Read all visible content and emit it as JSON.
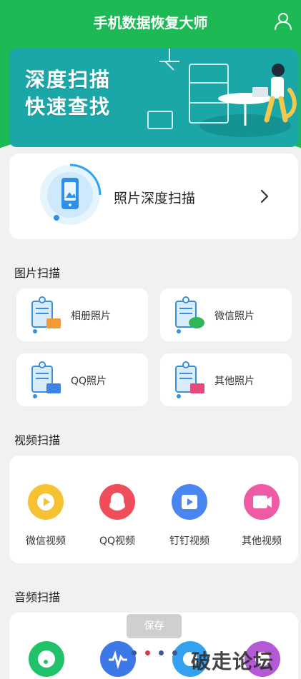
{
  "app": {
    "title": "手机数据恢复大师"
  },
  "banner": {
    "line1": "深度扫描",
    "line2": "快速查找"
  },
  "deep_scan": {
    "label": "照片深度扫描"
  },
  "image_scan": {
    "title": "图片扫描",
    "items": [
      {
        "label": "相册照片",
        "icon": "album-photo-icon",
        "accent": "#f29a38"
      },
      {
        "label": "微信照片",
        "icon": "wechat-photo-icon",
        "accent": "#2fb65a"
      },
      {
        "label": "QQ照片",
        "icon": "qq-photo-icon",
        "accent": "#3d82e6"
      },
      {
        "label": "其他照片",
        "icon": "other-photo-icon",
        "accent": "#e6497a"
      }
    ]
  },
  "video_scan": {
    "title": "视频扫描",
    "items": [
      {
        "label": "微信视频",
        "icon": "wechat-video-icon",
        "color": "#f6c234"
      },
      {
        "label": "QQ视频",
        "icon": "qq-video-icon",
        "color": "#f04d5a"
      },
      {
        "label": "钉钉视频",
        "icon": "dingtalk-video-icon",
        "color": "#4a86ef"
      },
      {
        "label": "其他视频",
        "icon": "other-video-icon",
        "color": "#ee5aa6"
      }
    ]
  },
  "audio_scan": {
    "title": "音频扫描"
  },
  "toast": {
    "label": "保存"
  },
  "pager": {
    "pages": 4,
    "active": 2,
    "active_color": "#e0364a",
    "inactive_color": "#3a5a8a"
  },
  "watermark": {
    "text": "破走论坛"
  }
}
